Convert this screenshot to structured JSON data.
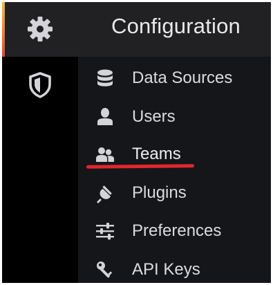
{
  "header": {
    "title": "Configuration",
    "icon": "gear-icon"
  },
  "rail": {
    "items": [
      {
        "icon": "shield-icon"
      }
    ]
  },
  "menu": {
    "items": [
      {
        "label": "Data Sources",
        "icon": "database-icon"
      },
      {
        "label": "Users",
        "icon": "user-icon"
      },
      {
        "label": "Teams",
        "icon": "users-icon",
        "active": true
      },
      {
        "label": "Plugins",
        "icon": "plug-icon"
      },
      {
        "label": "Preferences",
        "icon": "sliders-icon"
      },
      {
        "label": "API Keys",
        "icon": "key-icon"
      }
    ]
  },
  "colors": {
    "panel": "#000000",
    "header_bg": "#212124",
    "menu_bg": "#141619",
    "text": "#dcdce0",
    "highlight_underline": "#e3262d",
    "accent_top": "#f7b733",
    "accent_bottom": "#e8412f"
  }
}
